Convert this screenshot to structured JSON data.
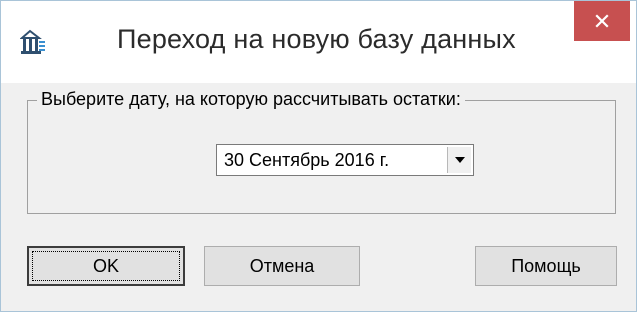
{
  "dialog": {
    "title": "Переход на новую базу данных",
    "icon": "database-archive-icon",
    "close_icon": "close-icon",
    "close_color": "#c75050"
  },
  "group": {
    "label": "Выберите дату, на которую рассчитывать остатки:"
  },
  "date_select": {
    "value": "30 Сентябрь 2016 г."
  },
  "buttons": {
    "ok": "OK",
    "cancel": "Отмена",
    "help": "Помощь"
  }
}
